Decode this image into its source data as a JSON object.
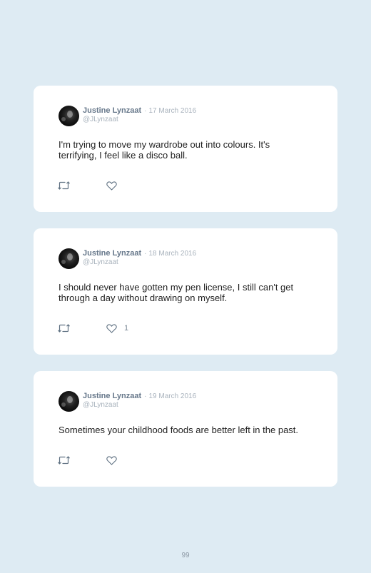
{
  "tweets": [
    {
      "name": "Justine Lynzaat",
      "separator": "·",
      "date": "17 March 2016",
      "handle": "@JLynzaat",
      "text": "I'm trying to move my wardrobe out into colours. It's terrifying, I feel like a disco ball.",
      "like_count": ""
    },
    {
      "name": "Justine Lynzaat",
      "separator": "·",
      "date": "18 March 2016",
      "handle": "@JLynzaat",
      "text": "I should never have gotten my pen license, I still can't get through a day without drawing on myself.",
      "like_count": "1"
    },
    {
      "name": "Justine Lynzaat",
      "separator": "·",
      "date": "19 March 2016",
      "handle": "@JLynzaat",
      "text": "Sometimes your childhood foods are better left in the past.",
      "like_count": ""
    }
  ],
  "page_number": "99",
  "icons": {
    "retweet": "retweet-icon",
    "like": "heart-icon"
  },
  "colors": {
    "background": "#deebf3",
    "card": "#ffffff",
    "name": "#66778a",
    "muted": "#a9b3bd"
  }
}
